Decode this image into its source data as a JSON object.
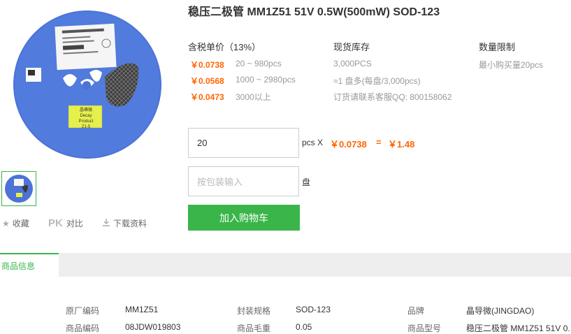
{
  "product": {
    "title": "稳压二极管 MM1Z51 51V 0.5W(500mW) SOD-123",
    "reel_label_line1": "晶導微",
    "reel_label_line2": "Decay Product",
    "reel_label_line3": "Z1-5"
  },
  "actions": {
    "favorite": "收藏",
    "pk_badge": "PK",
    "compare": "对比",
    "download": "下载资料"
  },
  "pricing": {
    "header": "含税单价（13%）",
    "tiers": [
      {
        "price": "￥0.0738",
        "range": "20 ~ 980pcs"
      },
      {
        "price": "￥0.0568",
        "range": "1000 ~ 2980pcs"
      },
      {
        "price": "￥0.0473",
        "range": "3000以上"
      }
    ]
  },
  "stock": {
    "header": "现货库存",
    "qty": "3,000PCS",
    "reels": "≈1 盘多(每盘/3,000pcs)",
    "contact": "订货请联系客服QQ: 800158062"
  },
  "limit": {
    "header": "数量限制",
    "min": "最小购买量20pcs"
  },
  "order": {
    "qty_value": "20",
    "qty_unit": "pcs X",
    "unit_price": "￥0.0738",
    "equals": "=",
    "total": "￥1.48",
    "pack_placeholder": "按包装输入",
    "pack_unit": "盘",
    "add_to_cart": "加入购物车"
  },
  "tabs": {
    "product_info": "商品信息"
  },
  "specs": {
    "row1": [
      {
        "label": "原厂编码",
        "value": "MM1Z51"
      },
      {
        "label": "封装规格",
        "value": "SOD-123"
      },
      {
        "label": "品牌",
        "value": "晶导微(JINGDAO)"
      }
    ],
    "row2": [
      {
        "label": "商品编码",
        "value": "08JDW019803"
      },
      {
        "label": "商品毛重",
        "value": "0.05"
      },
      {
        "label": "商品型号",
        "value": "稳压二极管 MM1Z51 51V 0."
      }
    ]
  },
  "colors": {
    "accent": "#39b54a",
    "price": "#ff6600",
    "reel": "#4d73d6"
  }
}
